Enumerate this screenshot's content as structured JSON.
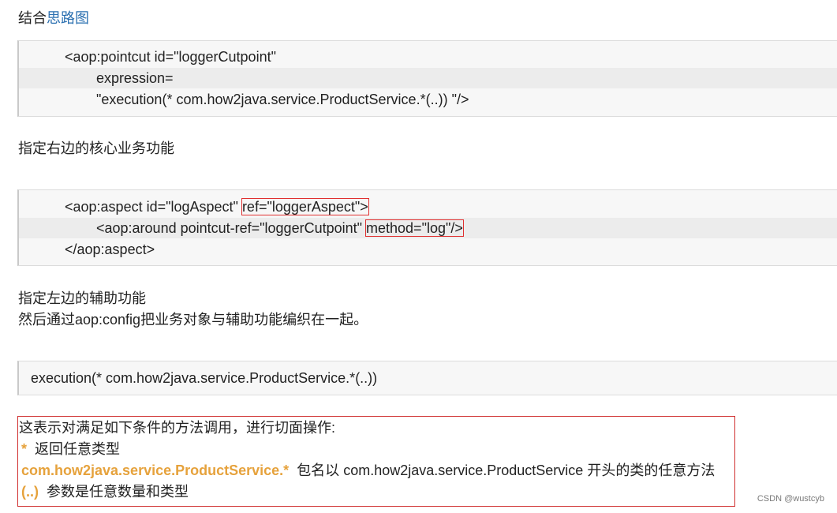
{
  "intro": {
    "prefix": "结合",
    "link": "思路图"
  },
  "code1": {
    "line1": "<aop:pointcut id=\"loggerCutpoint\"",
    "line2": "expression=",
    "line3": "\"execution(* com.how2java.service.ProductService.*(..)) \"/>"
  },
  "note1": "指定右边的核心业务功能",
  "code2": {
    "line1_a": "<aop:aspect id=\"logAspect\" ",
    "line1_hl": "ref=\"loggerAspect\">",
    "line2_a": "<aop:around pointcut-ref=\"loggerCutpoint\" ",
    "line2_hl": "method=\"log\"/>",
    "line3": "</aop:aspect>"
  },
  "note2": "指定左边的辅助功能",
  "note3": "然后通过aop:config把业务对象与辅助功能编织在一起。",
  "code3": {
    "line1": "execution(* com.how2java.service.ProductService.*(..))"
  },
  "explain": {
    "heading": "这表示对满足如下条件的方法调用，进行切面操作:",
    "item1_key": "*",
    "item1_desc": "返回任意类型",
    "item2_key": "com.how2java.service.ProductService.*",
    "item2_desc": "包名以 com.how2java.service.ProductService 开头的类的任意方法",
    "item3_key": "(..)",
    "item3_desc": "参数是任意数量和类型"
  },
  "watermark": "CSDN @wustcyb"
}
